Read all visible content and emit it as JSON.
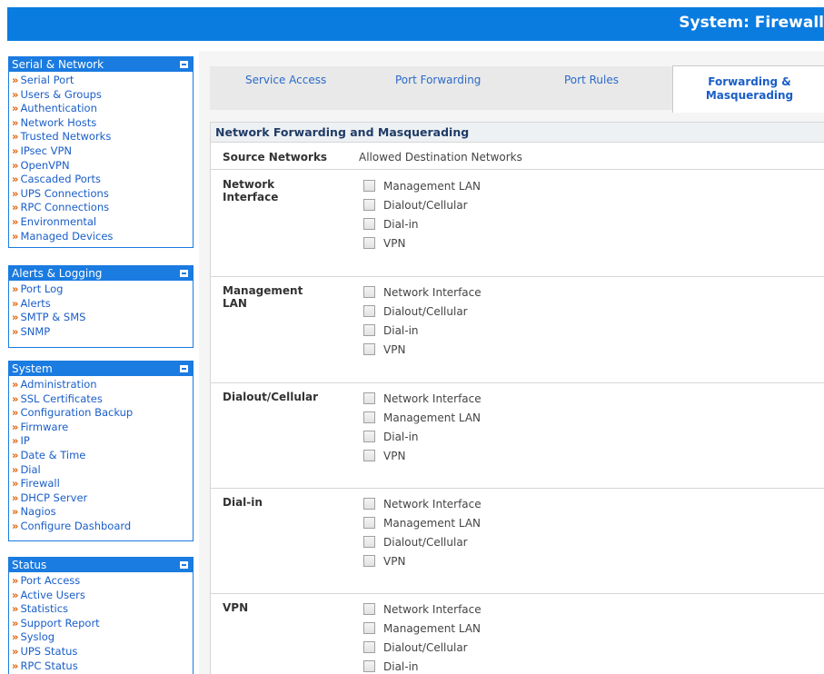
{
  "header": {
    "title": "System: Firewall"
  },
  "sidebar": {
    "serial_network": {
      "title": "Serial & Network",
      "items": [
        "Serial Port",
        "Users & Groups",
        "Authentication",
        "Network Hosts",
        "Trusted Networks",
        "IPsec VPN",
        "OpenVPN",
        "Cascaded Ports",
        "UPS Connections",
        "RPC Connections",
        "Environmental",
        "Managed Devices"
      ]
    },
    "alerts_logging": {
      "title": "Alerts & Logging",
      "items": [
        "Port Log",
        "Alerts",
        "SMTP & SMS",
        "SNMP"
      ]
    },
    "system": {
      "title": "System",
      "items": [
        "Administration",
        "SSL Certificates",
        "Configuration Backup",
        "Firmware",
        "IP",
        "Date & Time",
        "Dial",
        "Firewall",
        "DHCP Server",
        "Nagios",
        "Configure Dashboard"
      ]
    },
    "status": {
      "title": "Status",
      "items": [
        "Port Access",
        "Active Users",
        "Statistics",
        "Support Report",
        "Syslog",
        "UPS Status",
        "RPC Status"
      ]
    },
    "arrow": "»"
  },
  "tabs": {
    "service_access": "Service Access",
    "port_forwarding": "Port Forwarding",
    "port_rules": "Port Rules",
    "forwarding_line1": "Forwarding &",
    "forwarding_line2": "Masquerading"
  },
  "section": {
    "title": "Network Forwarding and Masquerading",
    "col_source": "Source Networks",
    "col_dest": "Allowed Destination Networks"
  },
  "rows": [
    {
      "source_line1": "Network",
      "source_line2": "Interface",
      "options": [
        "Management LAN",
        "Dialout/Cellular",
        "Dial-in",
        "VPN"
      ]
    },
    {
      "source_line1": "Management",
      "source_line2": "LAN",
      "options": [
        "Network Interface",
        "Dialout/Cellular",
        "Dial-in",
        "VPN"
      ]
    },
    {
      "source_line1": "Dialout/Cellular",
      "source_line2": "",
      "options": [
        "Network Interface",
        "Management LAN",
        "Dial-in",
        "VPN"
      ]
    },
    {
      "source_line1": "Dial-in",
      "source_line2": "",
      "options": [
        "Network Interface",
        "Management LAN",
        "Dialout/Cellular",
        "VPN"
      ]
    },
    {
      "source_line1": "VPN",
      "source_line2": "",
      "options": [
        "Network Interface",
        "Management LAN",
        "Dialout/Cellular",
        "Dial-in"
      ]
    }
  ],
  "colors": {
    "topbar": "#0a7ce0",
    "sidebar_border": "#1a7be0",
    "link": "#1a5ec8",
    "arrow": "#e05c00"
  }
}
